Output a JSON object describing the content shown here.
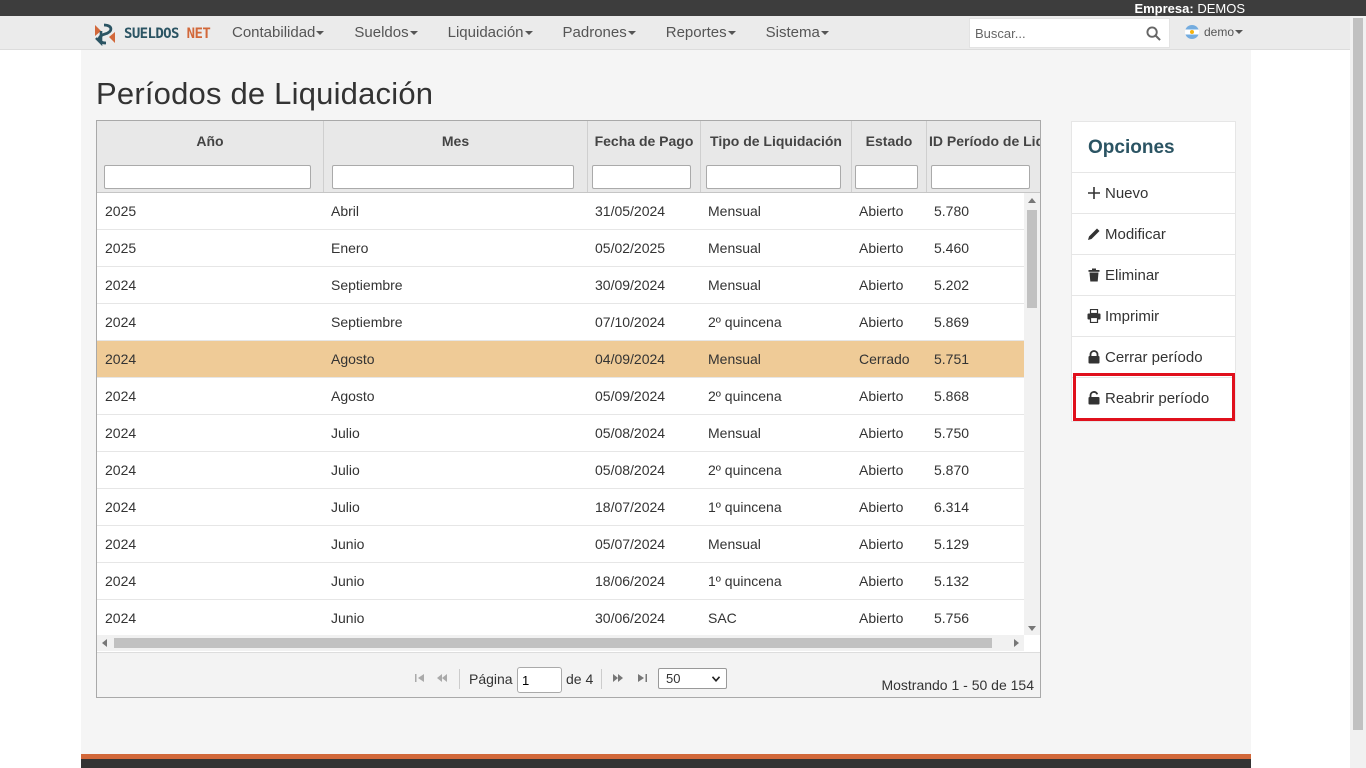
{
  "topbar": {
    "empresa_label": "Empresa:",
    "empresa_value": "DEMOS"
  },
  "nav": {
    "brand_a": "SUELDOS",
    "brand_b": "NET",
    "menu": [
      "Contabilidad",
      "Sueldos",
      "Liquidación",
      "Padrones",
      "Reportes",
      "Sistema"
    ],
    "search_placeholder": "Buscar...",
    "user": "demo"
  },
  "page": {
    "title": "Períodos de Liquidación"
  },
  "grid": {
    "columns": [
      "Año",
      "Mes",
      "Fecha de Pago",
      "Tipo de Liquidación",
      "Estado",
      "ID Período de Liquidación"
    ],
    "rows": [
      {
        "anio": "2025",
        "mes": "Abril",
        "fecha": "31/05/2024",
        "tipo": "Mensual",
        "estado": "Abierto",
        "id": "5.780"
      },
      {
        "anio": "2025",
        "mes": "Enero",
        "fecha": "05/02/2025",
        "tipo": "Mensual",
        "estado": "Abierto",
        "id": "5.460"
      },
      {
        "anio": "2024",
        "mes": "Septiembre",
        "fecha": "30/09/2024",
        "tipo": "Mensual",
        "estado": "Abierto",
        "id": "5.202"
      },
      {
        "anio": "2024",
        "mes": "Septiembre",
        "fecha": "07/10/2024",
        "tipo": "2º quincena",
        "estado": "Abierto",
        "id": "5.869"
      },
      {
        "anio": "2024",
        "mes": "Agosto",
        "fecha": "04/09/2024",
        "tipo": "Mensual",
        "estado": "Cerrado",
        "id": "5.751",
        "selected": true
      },
      {
        "anio": "2024",
        "mes": "Agosto",
        "fecha": "05/09/2024",
        "tipo": "2º quincena",
        "estado": "Abierto",
        "id": "5.868"
      },
      {
        "anio": "2024",
        "mes": "Julio",
        "fecha": "05/08/2024",
        "tipo": "Mensual",
        "estado": "Abierto",
        "id": "5.750"
      },
      {
        "anio": "2024",
        "mes": "Julio",
        "fecha": "05/08/2024",
        "tipo": "2º quincena",
        "estado": "Abierto",
        "id": "5.870"
      },
      {
        "anio": "2024",
        "mes": "Julio",
        "fecha": "18/07/2024",
        "tipo": "1º quincena",
        "estado": "Abierto",
        "id": "6.314"
      },
      {
        "anio": "2024",
        "mes": "Junio",
        "fecha": "05/07/2024",
        "tipo": "Mensual",
        "estado": "Abierto",
        "id": "5.129"
      },
      {
        "anio": "2024",
        "mes": "Junio",
        "fecha": "18/06/2024",
        "tipo": "1º quincena",
        "estado": "Abierto",
        "id": "5.132"
      },
      {
        "anio": "2024",
        "mes": "Junio",
        "fecha": "30/06/2024",
        "tipo": "SAC",
        "estado": "Abierto",
        "id": "5.756"
      }
    ],
    "selected_color": "#efcb97"
  },
  "pager": {
    "page_label": "Página",
    "page_value": "1",
    "of_label": "de 4",
    "page_size": "50",
    "info": "Mostrando 1 - 50 de 154"
  },
  "options": {
    "title": "Opciones",
    "items": [
      {
        "label": "Nuevo",
        "icon": "plus-icon"
      },
      {
        "label": "Modificar",
        "icon": "pencil-icon"
      },
      {
        "label": "Eliminar",
        "icon": "trash-icon"
      },
      {
        "label": "Imprimir",
        "icon": "printer-icon"
      },
      {
        "label": "Cerrar período",
        "icon": "lock-icon"
      },
      {
        "label": "Reabrir período",
        "icon": "unlock-icon",
        "highlighted": true
      }
    ],
    "highlight_color": "#e0101c"
  },
  "colors": {
    "brand_dark": "#2b5463",
    "brand_orange": "#d2683a"
  }
}
